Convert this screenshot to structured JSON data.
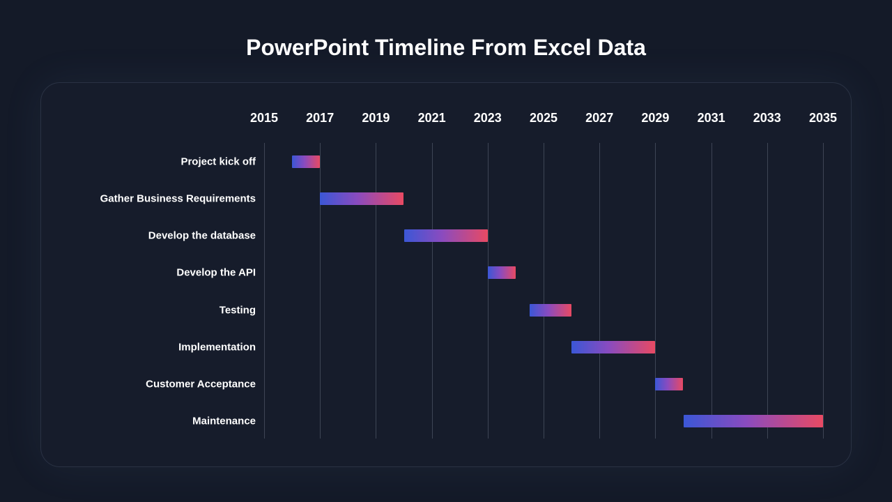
{
  "title": "PowerPoint Timeline From Excel Data",
  "chart_data": {
    "type": "bar",
    "orientation": "horizontal-gantt",
    "xlabel": "",
    "ylabel": "",
    "x_min": 2015,
    "x_max": 2035,
    "x_ticks": [
      2015,
      2017,
      2019,
      2021,
      2023,
      2025,
      2027,
      2029,
      2031,
      2033,
      2035
    ],
    "tasks": [
      {
        "name": "Project kick off",
        "start": 2016,
        "end": 2017
      },
      {
        "name": "Gather Business Requirements",
        "start": 2017,
        "end": 2020
      },
      {
        "name": "Develop the database",
        "start": 2020,
        "end": 2023
      },
      {
        "name": "Develop the API",
        "start": 2023,
        "end": 2024
      },
      {
        "name": "Testing",
        "start": 2024.5,
        "end": 2026
      },
      {
        "name": "Implementation",
        "start": 2026,
        "end": 2029
      },
      {
        "name": "Customer Acceptance",
        "start": 2029,
        "end": 2030
      },
      {
        "name": "Maintenance",
        "start": 2030,
        "end": 2035
      }
    ],
    "bar_gradient": [
      "#3b57d6",
      "#8a4bbf",
      "#e84a63"
    ],
    "gridline_color": "#5a6172",
    "background": "#161c2b"
  }
}
